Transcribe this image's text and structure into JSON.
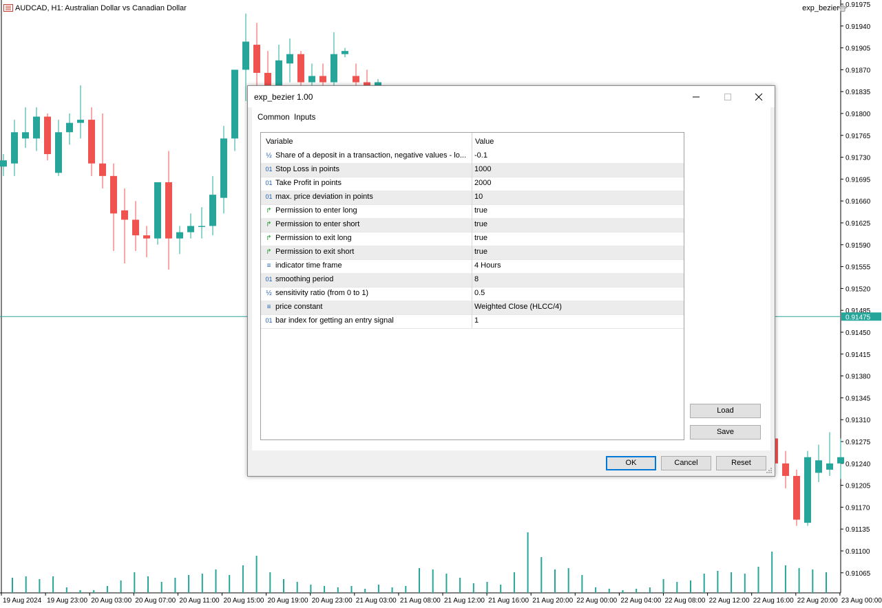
{
  "chart": {
    "symbol_label": "AUDCAD, H1:  Australian Dollar vs Canadian Dollar",
    "ea_label": "exp_bezier",
    "current_price": "0.91475",
    "colors": {
      "bull": "#26a69a",
      "bear": "#ef5350",
      "price_line": "#26a69a"
    },
    "price_ticks": [
      "0.91975",
      "0.91940",
      "0.91905",
      "0.91870",
      "0.91835",
      "0.91800",
      "0.91765",
      "0.91730",
      "0.91695",
      "0.91660",
      "0.91625",
      "0.91590",
      "0.91555",
      "0.91520",
      "0.91485",
      "0.91450",
      "0.91415",
      "0.91380",
      "0.91345",
      "0.91310",
      "0.91275",
      "0.91240",
      "0.91205",
      "0.91170",
      "0.91135",
      "0.91100",
      "0.91065"
    ],
    "time_ticks": [
      "19 Aug 2024",
      "19 Aug 23:00",
      "20 Aug 03:00",
      "20 Aug 07:00",
      "20 Aug 11:00",
      "20 Aug 15:00",
      "20 Aug 19:00",
      "20 Aug 23:00",
      "21 Aug 03:00",
      "21 Aug 08:00",
      "21 Aug 12:00",
      "21 Aug 16:00",
      "21 Aug 20:00",
      "22 Aug 00:00",
      "22 Aug 04:00",
      "22 Aug 08:00",
      "22 Aug 12:00",
      "22 Aug 16:00",
      "22 Aug 20:00",
      "23 Aug 00:00"
    ]
  },
  "dialog": {
    "title": "exp_bezier 1.00",
    "tabs": [
      "Common",
      "Inputs"
    ],
    "active_tab": "Inputs",
    "columns": [
      "Variable",
      "Value"
    ],
    "rows": [
      {
        "icon": "fraction-icon",
        "variable": "Share of a deposit in a transaction, negative values - lo...",
        "value": "-0.1"
      },
      {
        "icon": "integer-icon",
        "variable": "Stop Loss in points",
        "value": "1000"
      },
      {
        "icon": "integer-icon",
        "variable": "Take Profit in points",
        "value": "2000"
      },
      {
        "icon": "integer-icon",
        "variable": "max. price deviation in points",
        "value": "10"
      },
      {
        "icon": "bool-icon",
        "variable": "Permission to enter long",
        "value": "true"
      },
      {
        "icon": "bool-icon",
        "variable": "Permission to enter short",
        "value": "true"
      },
      {
        "icon": "bool-icon",
        "variable": "Permission to exit long",
        "value": "true"
      },
      {
        "icon": "bool-icon",
        "variable": "Permission to exit short",
        "value": "true"
      },
      {
        "icon": "enum-icon",
        "variable": "indicator time frame",
        "value": "4 Hours"
      },
      {
        "icon": "integer-icon",
        "variable": "smoothing period",
        "value": "8"
      },
      {
        "icon": "fraction-icon",
        "variable": "sensitivity ratio (from 0 to 1)",
        "value": "0.5"
      },
      {
        "icon": "enum-icon",
        "variable": "price constant",
        "value": "Weighted Close (HLCC/4)"
      },
      {
        "icon": "integer-icon",
        "variable": "bar index for getting an entry signal",
        "value": "1"
      }
    ],
    "buttons": {
      "load": "Load",
      "save": "Save",
      "ok": "OK",
      "cancel": "Cancel",
      "reset": "Reset"
    }
  }
}
